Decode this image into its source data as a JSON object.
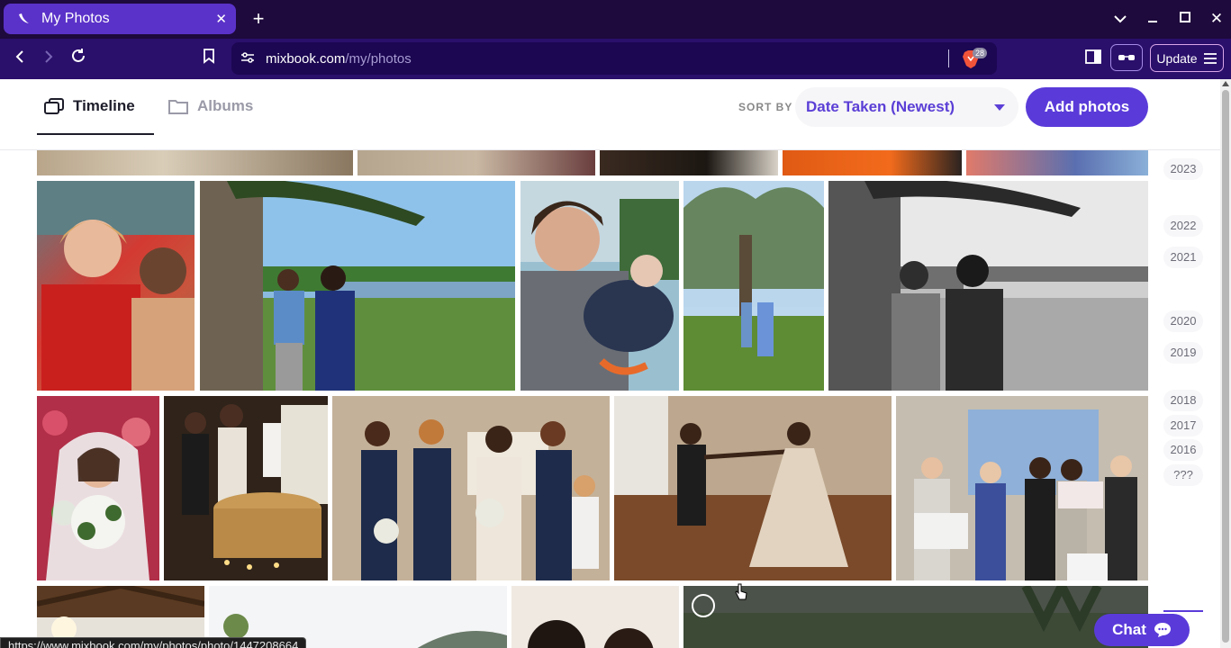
{
  "browser": {
    "tab_title": "My Photos",
    "url_host": "mixbook.com",
    "url_path": "/my/photos",
    "brave_badge": "28",
    "update_label": "Update",
    "status_url": "https://www.mixbook.com/my/photos/photo/1447208664"
  },
  "header": {
    "tabs": [
      {
        "label": "Timeline",
        "icon": "timeline-icon",
        "active": true
      },
      {
        "label": "Albums",
        "icon": "folder-icon",
        "active": false
      }
    ],
    "sort_by_label": "SORT BY",
    "sort_value": "Date Taken (Newest)",
    "add_photos_label": "Add photos"
  },
  "years": [
    "2023",
    "2022",
    "2021",
    "2020",
    "2019",
    "2018",
    "2017",
    "2016",
    "???"
  ],
  "chat_label": "Chat",
  "colors": {
    "accent": "#5a3bd9",
    "tabbar": "#1e0a3c",
    "navbar": "#2a0f6b"
  }
}
